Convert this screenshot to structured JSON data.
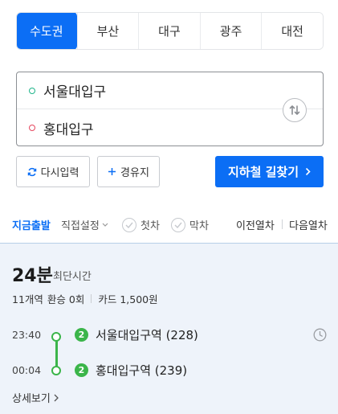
{
  "region_tabs": [
    {
      "label": "수도권",
      "active": true
    },
    {
      "label": "부산",
      "active": false
    },
    {
      "label": "대구",
      "active": false
    },
    {
      "label": "광주",
      "active": false
    },
    {
      "label": "대전",
      "active": false
    }
  ],
  "stations": {
    "from": "서울대입구",
    "to": "홍대입구",
    "from_icon": "green-dot-icon",
    "to_icon": "red-dot-icon",
    "swap_icon": "swap-arrows-icon"
  },
  "actions": {
    "reset_label": "다시입력",
    "via_label": "경유지",
    "search_label": "지하철 길찾기"
  },
  "options": {
    "now": "지금출발",
    "direct": "직접설정",
    "first_train": "첫차",
    "last_train": "막차",
    "prev_train": "이전열차",
    "next_train": "다음열차"
  },
  "result": {
    "duration": "24분",
    "duration_label": "최단시간",
    "stations_count": "11개역",
    "transfer": "환승 0회",
    "fare": "카드 1,500원",
    "stops": [
      {
        "time": "23:40",
        "line": "2",
        "name": "서울대입구역 (228)"
      },
      {
        "time": "00:04",
        "line": "2",
        "name": "홍대입구역 (239)"
      }
    ],
    "detail_label": "상세보기"
  },
  "colors": {
    "accent": "#0b6ef5",
    "line2": "#3bb54a",
    "result_bg": "#eef3fa"
  }
}
